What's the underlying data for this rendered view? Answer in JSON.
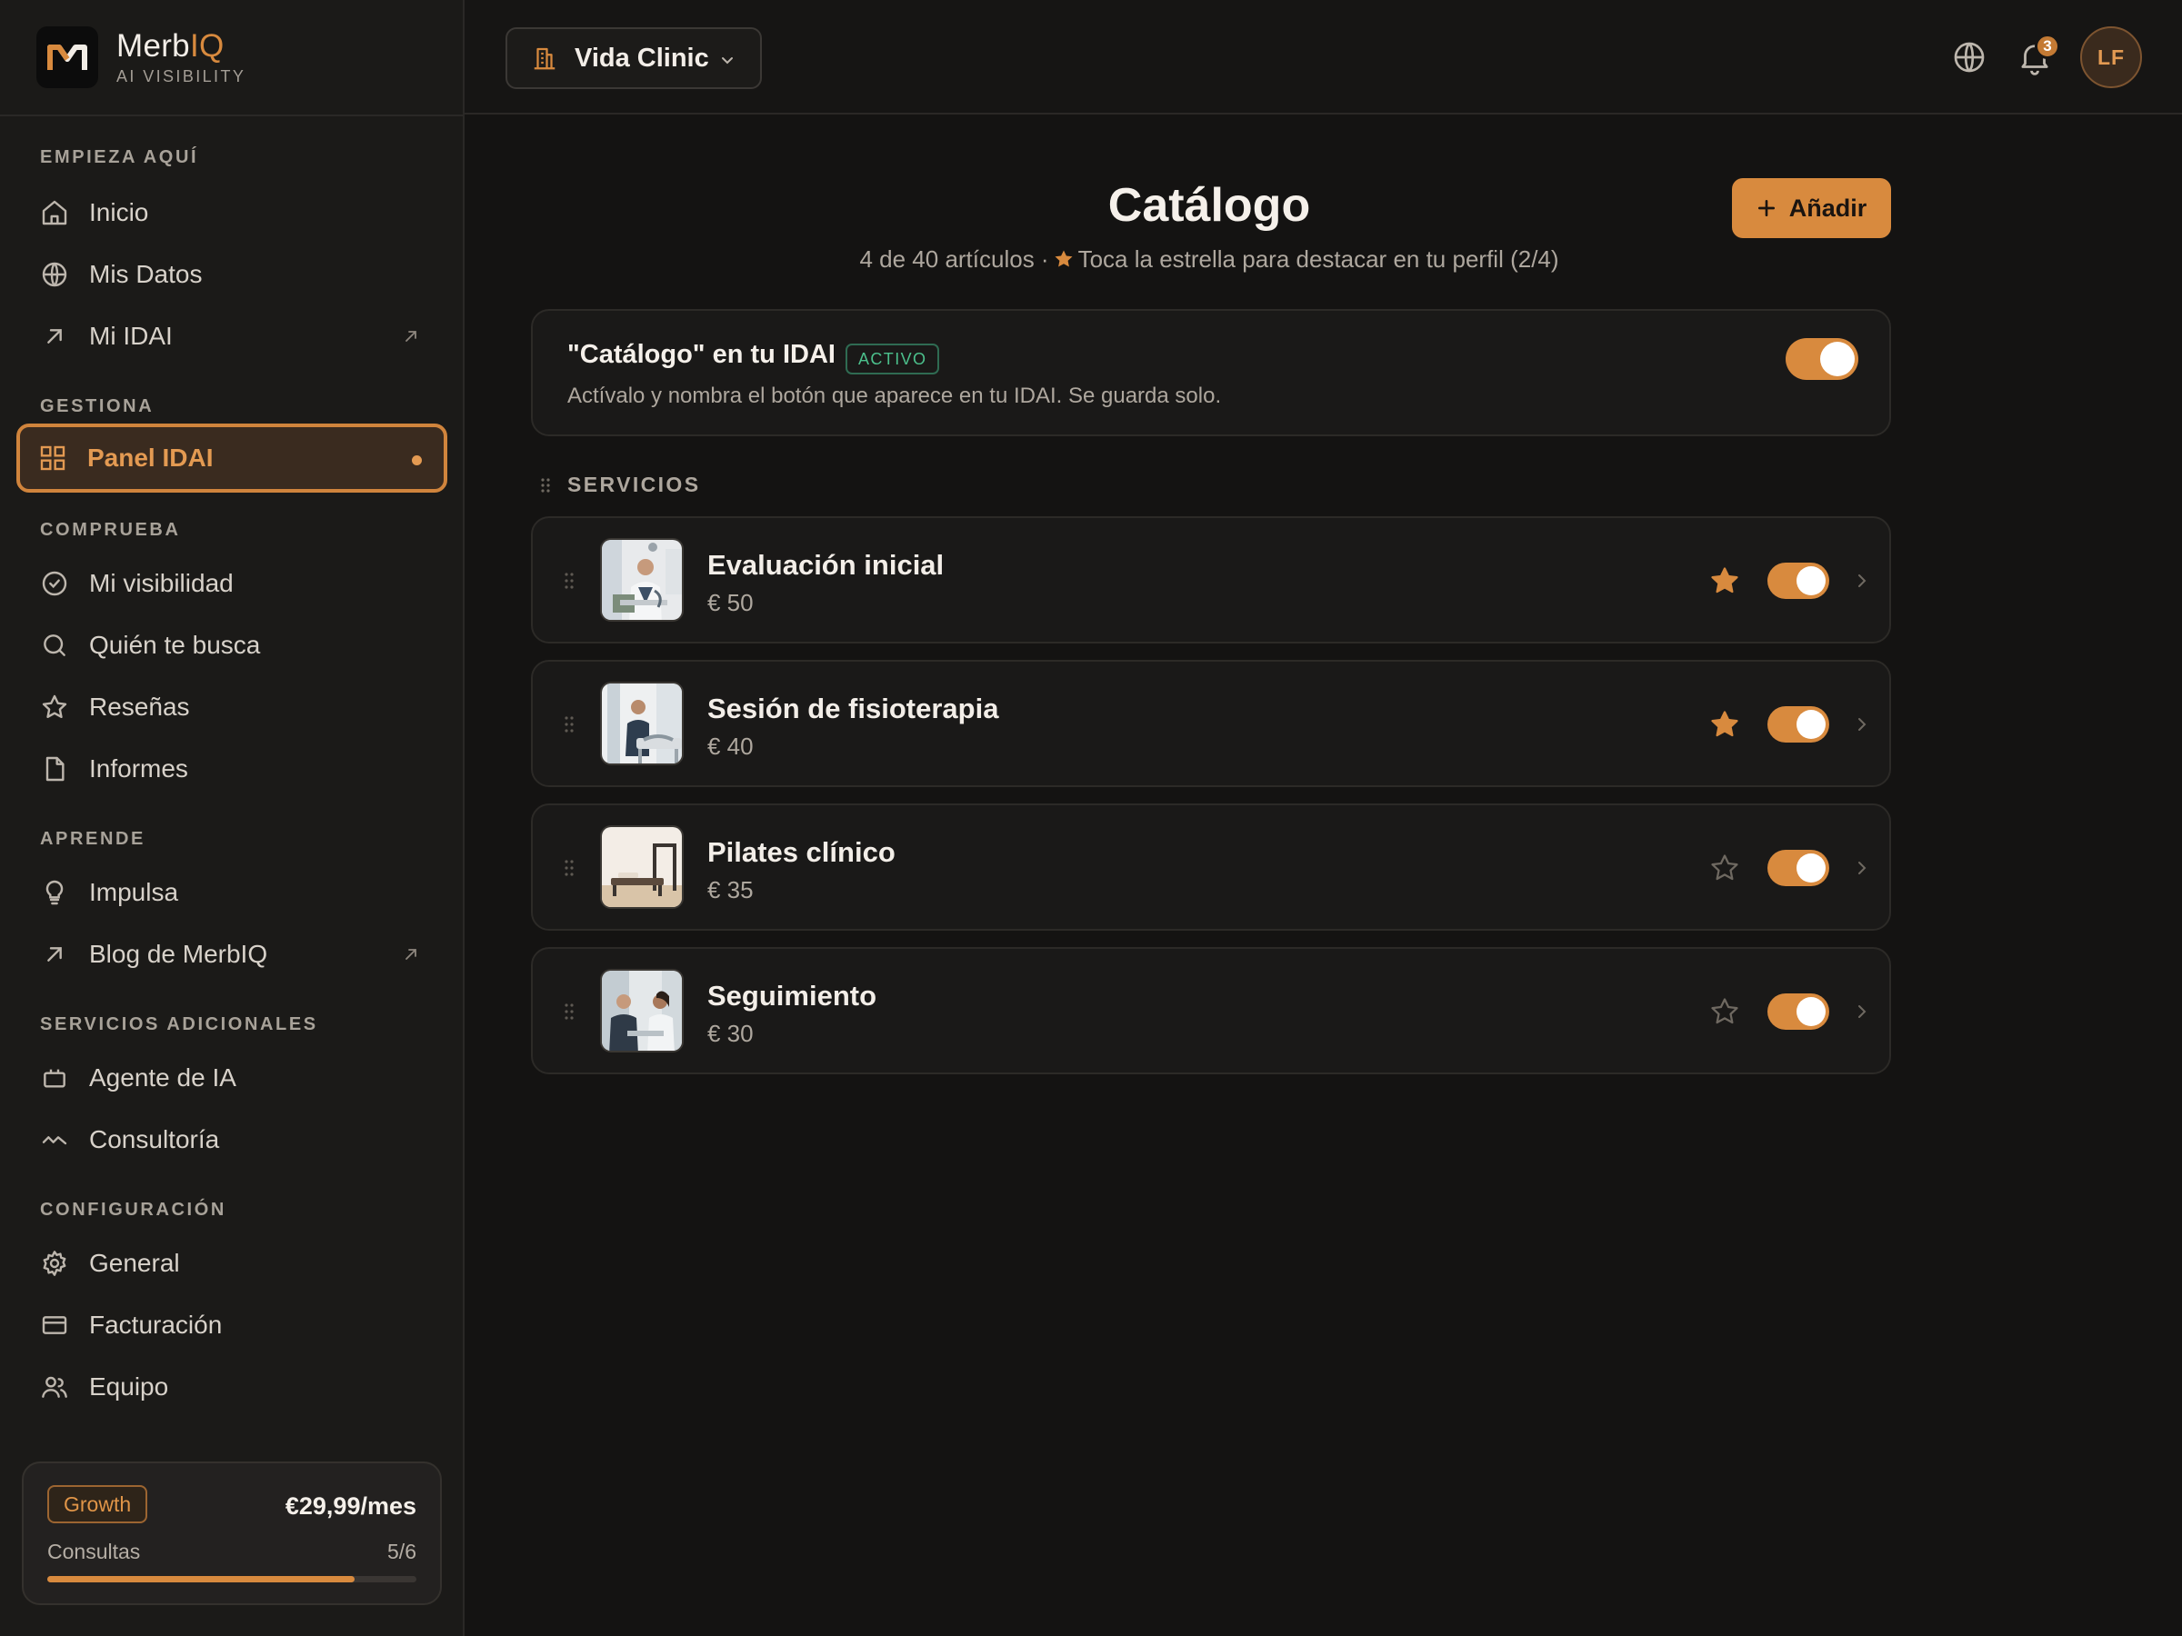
{
  "brand": {
    "name_main": "Merb",
    "name_accent": "IQ",
    "subtitle": "AI VISIBILITY"
  },
  "sidebar": {
    "sections": {
      "start": "EMPIEZA AQUÍ",
      "manage": "GESTIONA",
      "check": "COMPRUEBA",
      "learn": "APRENDE",
      "extra": "SERVICIOS ADICIONALES",
      "config": "CONFIGURACIÓN"
    },
    "items": {
      "inicio": "Inicio",
      "mis_datos": "Mis Datos",
      "mi_idai": "Mi IDAI",
      "panel_idai": "Panel IDAI",
      "mi_visibilidad": "Mi visibilidad",
      "quien_te_busca": "Quién te busca",
      "resenas": "Reseñas",
      "informes": "Informes",
      "impulsa": "Impulsa",
      "blog": "Blog de MerbIQ",
      "agente": "Agente de IA",
      "consultoria": "Consultoría",
      "general": "General",
      "facturacion": "Facturación",
      "equipo": "Equipo"
    },
    "active_item": "Panel IDAI"
  },
  "plan": {
    "name": "Growth",
    "price": "€29,99/mes",
    "usage_label": "Consultas",
    "usage_count": "5/6",
    "usage_fraction": 0.833
  },
  "topbar": {
    "org_name": "Vida Clinic",
    "notifications_count": "3",
    "avatar_initials": "LF"
  },
  "main": {
    "title": "Catálogo",
    "subtitle_count": "4 de 40 artículos ·",
    "subtitle_hint": "Toca la estrella para destacar en tu perfil (2/4)",
    "add_label": "Añadir",
    "settings": {
      "title": "\"Catálogo\" en tu IDAI",
      "badge": "ACTIVO",
      "description": "Actívalo y nombra el botón que aparece en tu IDAI. Se guarda solo.",
      "enabled": true
    },
    "section_label": "SERVICIOS",
    "items": [
      {
        "name": "Evaluación inicial",
        "price": "€ 50",
        "featured": true,
        "enabled": true
      },
      {
        "name": "Sesión de fisioterapia",
        "price": "€ 40",
        "featured": true,
        "enabled": true
      },
      {
        "name": "Pilates clínico",
        "price": "€ 35",
        "featured": false,
        "enabled": true
      },
      {
        "name": "Seguimiento",
        "price": "€ 30",
        "featured": false,
        "enabled": true
      }
    ]
  },
  "colors": {
    "accent": "#d88a3e",
    "background": "#141312",
    "sidebar": "#1b1a18",
    "active_badge": "#4cc08c"
  }
}
